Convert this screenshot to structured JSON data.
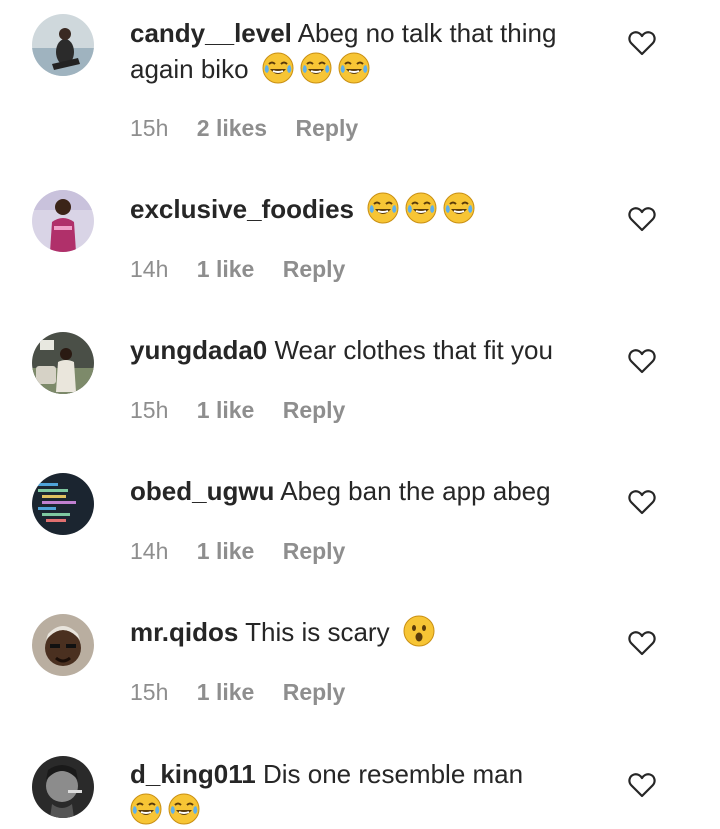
{
  "comments": [
    {
      "username": "candy__level",
      "text": "Abeg no talk that thing again biko",
      "emojis": [
        "joy-emoji",
        "joy-emoji",
        "joy-emoji"
      ],
      "time": "15h",
      "likes": "2 likes",
      "reply": "Reply"
    },
    {
      "username": "exclusive_foodies",
      "text": "",
      "emojis": [
        "joy-emoji",
        "joy-emoji",
        "joy-emoji"
      ],
      "time": "14h",
      "likes": "1 like",
      "reply": "Reply"
    },
    {
      "username": "yungdada0",
      "text": "Wear clothes that fit you",
      "emojis": [],
      "time": "15h",
      "likes": "1 like",
      "reply": "Reply"
    },
    {
      "username": "obed_ugwu",
      "text": "Abeg ban the app abeg",
      "emojis": [],
      "time": "14h",
      "likes": "1 like",
      "reply": "Reply"
    },
    {
      "username": "mr.qidos",
      "text": "This is scary",
      "emojis": [
        "surprised-emoji"
      ],
      "time": "15h",
      "likes": "1 like",
      "reply": "Reply"
    },
    {
      "username": "d_king011",
      "text": "Dis one resemble man",
      "emojis": [
        "joy-emoji",
        "joy-emoji"
      ],
      "time": "",
      "likes": "",
      "reply": ""
    }
  ],
  "colors": {
    "text": "#262626",
    "meta": "#8e8e8e",
    "emoji_face": "#f7c535"
  }
}
